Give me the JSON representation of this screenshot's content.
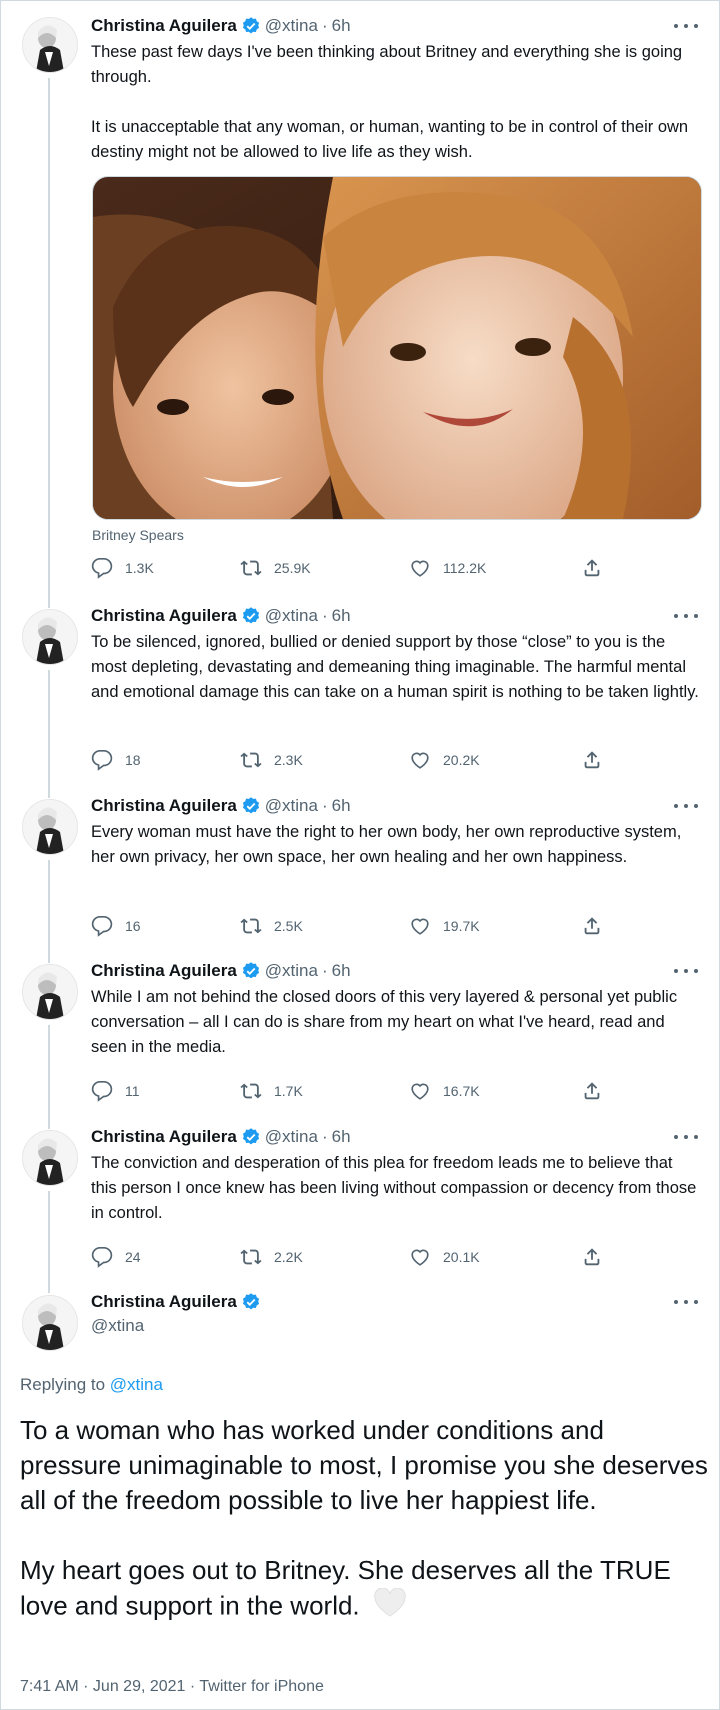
{
  "author": {
    "name": "Christina Aguilera",
    "handle": "@xtina",
    "time": "6h",
    "separator": "·"
  },
  "tweets": [
    {
      "paragraphs": [
        "These past few days I've been thinking about Britney and everything she is going through.",
        "It is unacceptable that any woman, or human, wanting to be in control of their own destiny might not be allowed to live life as they wish."
      ],
      "media_caption": "Britney Spears",
      "stats": {
        "replies": "1.3K",
        "retweets": "25.9K",
        "likes": "112.2K"
      }
    },
    {
      "paragraphs": [
        "To be silenced, ignored, bullied or denied support by those “close” to you is the most depleting, devastating and demeaning thing imaginable. The harmful mental and emotional damage this can take on a human spirit is nothing to be taken lightly."
      ],
      "stats": {
        "replies": "18",
        "retweets": "2.3K",
        "likes": "20.2K"
      }
    },
    {
      "paragraphs": [
        "Every woman must have the right to her own body, her own reproductive system, her own privacy, her own space, her own healing and her own happiness."
      ],
      "stats": {
        "replies": "16",
        "retweets": "2.5K",
        "likes": "19.7K"
      }
    },
    {
      "paragraphs": [
        "While I am not behind the closed doors of this very layered & personal yet public conversation – all I can do is share from my heart on what I've heard, read and seen in the media."
      ],
      "stats": {
        "replies": "11",
        "retweets": "1.7K",
        "likes": "16.7K"
      }
    },
    {
      "paragraphs": [
        "The conviction and desperation of this plea for freedom leads me to believe that this person I once knew has been living without compassion or decency from those in control."
      ],
      "stats": {
        "replies": "24",
        "retweets": "2.2K",
        "likes": "20.1K"
      }
    }
  ],
  "main_tweet": {
    "replying_prefix": "Replying to",
    "replying_handle": "@xtina",
    "paragraphs": [
      "To a woman who has worked under conditions and pressure unimaginable to most, I promise you she deserves all of the freedom possible to live her happiest life.",
      "My heart goes out to Britney. She deserves all the TRUE love and support in the world."
    ],
    "timestamp": "7:41 AM · Jun 29, 2021 · Twitter for iPhone"
  },
  "icons": {
    "verified": "verified-badge-icon",
    "more": "more-dots-icon",
    "reply": "reply-icon",
    "retweet": "retweet-icon",
    "like": "heart-icon",
    "share": "share-icon",
    "white_heart": "white-heart-emoji-icon"
  },
  "colors": {
    "accent": "#1d9bf0",
    "text": "#0f1419",
    "muted": "#536471",
    "border": "#cfd9de"
  }
}
